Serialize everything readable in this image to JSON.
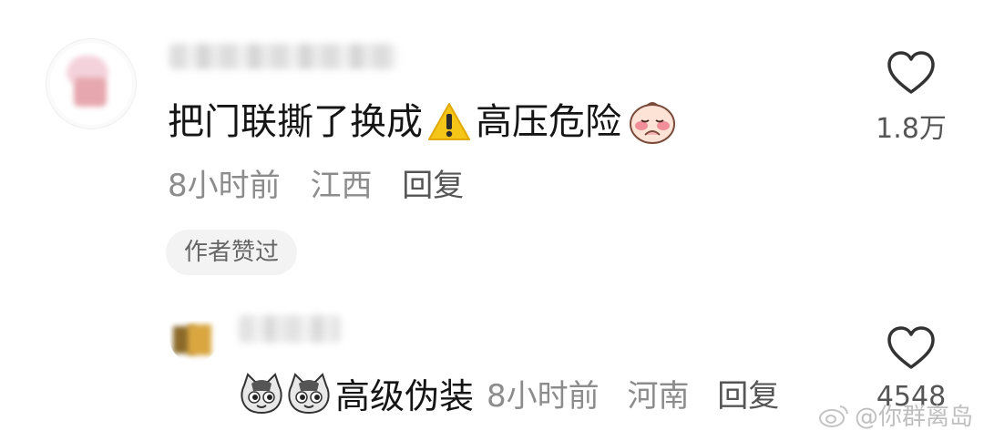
{
  "comment": {
    "text_before": "把门联撕了换成",
    "text_after": "高压危险",
    "time": "8小时前",
    "location": "江西",
    "reply_label": "回复",
    "author_badge": "作者赞过",
    "like_count": "1.8万"
  },
  "reply": {
    "text": "高级伪装",
    "time": "8小时前",
    "location": "河南",
    "reply_label": "回复",
    "like_count": "4548"
  },
  "watermark": {
    "handle": "@你群离岛"
  },
  "icons": {
    "like": "heart-outline-icon",
    "warning": "warning-sign-icon",
    "emoji": "shy-face-emoji-icon",
    "cat": "cat-face-emoji-icon",
    "weibo": "weibo-logo-icon"
  },
  "colors": {
    "text": "#151515",
    "meta": "#8c8c8c",
    "badge_bg": "#f3f3f3",
    "warning": "#f5c518"
  }
}
